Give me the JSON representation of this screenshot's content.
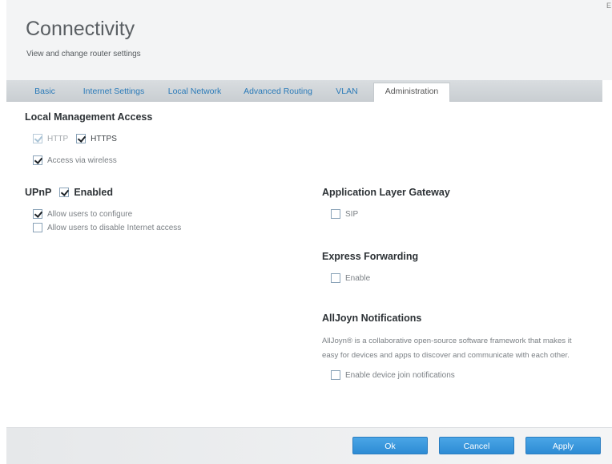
{
  "header": {
    "title": "Connectivity",
    "subtitle": "View and change router settings",
    "corner_text": "E"
  },
  "tabs": [
    {
      "label": "Basic",
      "active": false
    },
    {
      "label": "Internet Settings",
      "active": false
    },
    {
      "label": "Local Network",
      "active": false
    },
    {
      "label": "Advanced Routing",
      "active": false
    },
    {
      "label": "VLAN",
      "active": false
    },
    {
      "label": "Administration",
      "active": true
    }
  ],
  "local_management": {
    "title": "Local Management Access",
    "http": {
      "label": "HTTP",
      "checked": true
    },
    "https": {
      "label": "HTTPS",
      "checked": true
    },
    "wireless": {
      "label": "Access via wireless",
      "checked": true
    }
  },
  "upnp": {
    "title": "UPnP",
    "enabled": {
      "label": "Enabled",
      "checked": true
    },
    "allow_configure": {
      "label": "Allow users to configure",
      "checked": true
    },
    "allow_disable": {
      "label": "Allow users to disable Internet access",
      "checked": false
    }
  },
  "alg": {
    "title": "Application Layer Gateway",
    "sip": {
      "label": "SIP",
      "checked": false
    }
  },
  "express": {
    "title": "Express Forwarding",
    "enable": {
      "label": "Enable",
      "checked": false
    }
  },
  "alljoyn": {
    "title": "AllJoyn Notifications",
    "desc_line1": "AllJoyn® is a collaborative open-source software framework that makes it",
    "desc_line2": "easy for devices and apps to discover and communicate with each other.",
    "join": {
      "label": "Enable device join notifications",
      "checked": false
    }
  },
  "footer": {
    "ok_label": "Ok",
    "cancel_label": "Cancel",
    "apply_label": "Apply"
  },
  "colors": {
    "accent": "#2d8bd4",
    "tab_link": "#2a7ab8"
  }
}
